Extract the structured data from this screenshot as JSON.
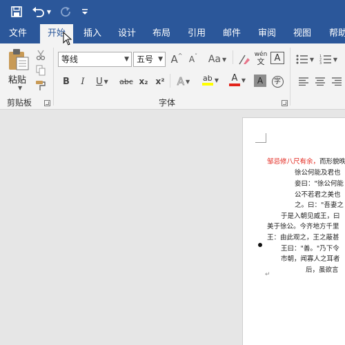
{
  "qat": {
    "save_icon": "save-icon",
    "undo_icon": "undo-icon",
    "redo_icon": "redo-icon",
    "customize_icon": "customize-qat-icon"
  },
  "tabs": [
    "文件",
    "开始",
    "插入",
    "设计",
    "布局",
    "引用",
    "邮件",
    "审阅",
    "视图",
    "帮助"
  ],
  "active_tab": "开始",
  "clipboard": {
    "paste_label": "粘贴",
    "group_label": "剪贴板"
  },
  "font": {
    "font_name": "等线",
    "font_size": "五号",
    "group_label": "字体",
    "phonetic_top": "wén",
    "phonetic_bottom": "文",
    "char_border": "A",
    "grow": "A",
    "shrink": "A",
    "change_case": "Aa",
    "bold": "B",
    "italic": "I",
    "underline": "U",
    "strike": "abc",
    "subscript": "x₂",
    "superscript": "x²",
    "text_effects": "A",
    "highlight": "ab",
    "font_color": "A",
    "char_shading": "A",
    "enclose": "字"
  },
  "colors": {
    "brand": "#2b579a",
    "highlight": "#ffff00",
    "font_color": "#e2231a"
  },
  "document": {
    "line1_red": "邹忌修八尺有余，",
    "line1_rest": "而形貌昳",
    "line2": "徐公何能及君也",
    "line3": "妾曰：\"徐公何能",
    "line4": "公不若君之美也",
    "line5": "之。曰：\"吾妻之",
    "line6": "于是入朝见威王，曰",
    "line7": "美于徐公。今齐地方千里",
    "line8": "王：由此观之，王之蔽甚",
    "line9": "王曰：\"善。\"乃下令",
    "line10": "市朝，闻寡人之耳者",
    "line11": "后，虽欲言"
  }
}
